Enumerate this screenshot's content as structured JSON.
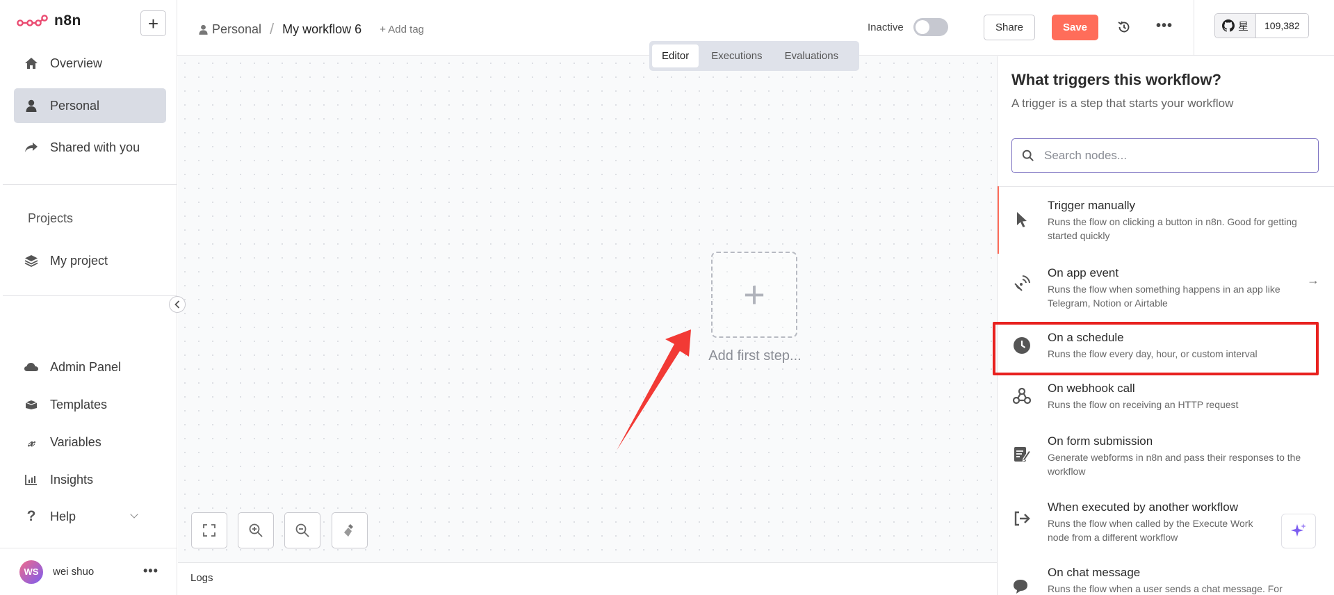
{
  "app": {
    "name": "n8n"
  },
  "sidebar": {
    "items": [
      {
        "label": "Overview",
        "icon": "home-icon"
      },
      {
        "label": "Personal",
        "icon": "user-icon",
        "active": true
      },
      {
        "label": "Shared with you",
        "icon": "share-icon"
      }
    ],
    "projects_title": "Projects",
    "projects": [
      {
        "label": "My project",
        "icon": "layers-icon"
      }
    ],
    "bottom_items": [
      {
        "label": "Admin Panel",
        "icon": "cloud-icon"
      },
      {
        "label": "Templates",
        "icon": "box-icon"
      },
      {
        "label": "Variables",
        "icon": "variable-icon"
      },
      {
        "label": "Insights",
        "icon": "chart-icon"
      },
      {
        "label": "Help",
        "icon": "question-icon"
      }
    ],
    "user": {
      "initials": "WS",
      "name": "wei shuo"
    }
  },
  "header": {
    "breadcrumb_project": "Personal",
    "breadcrumb_separator": "/",
    "workflow_name": "My workflow 6",
    "add_tag": "+ Add tag",
    "status_label": "Inactive",
    "share_label": "Share",
    "save_label": "Save",
    "github_star_label": "星",
    "github_stars": "109,382"
  },
  "tabs": [
    {
      "label": "Editor",
      "active": true
    },
    {
      "label": "Executions"
    },
    {
      "label": "Evaluations"
    }
  ],
  "canvas": {
    "add_first_step": "Add first step...",
    "logs_label": "Logs"
  },
  "trigger_panel": {
    "title": "What triggers this workflow?",
    "subtitle": "A trigger is a step that starts your workflow",
    "search_placeholder": "Search nodes...",
    "nodes": [
      {
        "title": "Trigger manually",
        "description": "Runs the flow on clicking a button in n8n. Good for getting started quickly",
        "icon": "cursor-icon"
      },
      {
        "title": "On app event",
        "description": "Runs the flow when something happens in an app like Telegram, Notion or Airtable",
        "icon": "satellite-icon"
      },
      {
        "title": "On a schedule",
        "description": "Runs the flow every day, hour, or custom interval",
        "icon": "clock-icon"
      },
      {
        "title": "On webhook call",
        "description": "Runs the flow on receiving an HTTP request",
        "icon": "webhook-icon"
      },
      {
        "title": "On form submission",
        "description": "Generate webforms in n8n and pass their responses to the workflow",
        "icon": "form-icon"
      },
      {
        "title": "When executed by another workflow",
        "description": "Runs the flow when called by the Execute Workflow node from a different workflow",
        "icon": "sign-in-icon"
      },
      {
        "title": "On chat message",
        "description": "Runs the flow when a user sends a chat message. For",
        "icon": "chat-icon"
      }
    ]
  },
  "colors": {
    "accent": "#ff6d5a",
    "highlight": "#e8211f",
    "active_nav_bg": "#d9dce4",
    "brand": "#ea4b71"
  }
}
